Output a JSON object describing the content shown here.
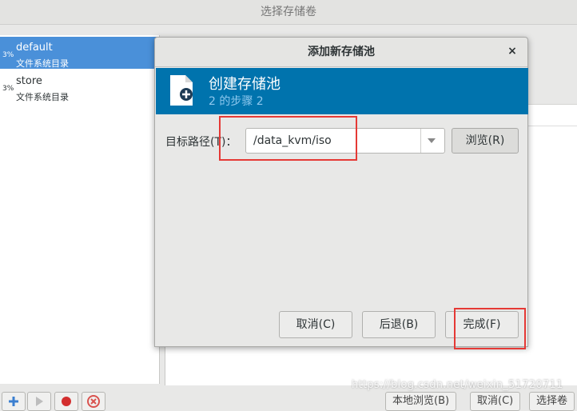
{
  "window": {
    "title": "选择存储卷"
  },
  "pools": [
    {
      "percent": "3%",
      "name": "default",
      "type": "文件系统目录",
      "selected": true
    },
    {
      "percent": "3%",
      "name": "store",
      "type": "文件系统目录",
      "selected": false
    }
  ],
  "bottom_buttons": {
    "browse_local": "本地浏览(B)",
    "cancel": "取消(C)",
    "choose_volume": "选择卷"
  },
  "dialog": {
    "title": "添加新存储池",
    "close_glyph": "×",
    "banner_title": "创建存储池",
    "banner_step": "2 的步骤 2",
    "target_path_label": "目标路径(T)：",
    "target_path_value": "/data_kvm/iso",
    "browse_label": "浏览(R)",
    "cancel_label": "取消(C)",
    "back_label": "后退(B)",
    "finish_label": "完成(F)"
  },
  "watermark": "https://blog.csdn.net/weixin_51720711",
  "icons": {
    "banner": "new-document-plus-icon",
    "add": "plus-icon",
    "play": "play-icon",
    "stop": "stop-icon",
    "delete": "delete-icon"
  },
  "colors": {
    "banner": "#0073ad",
    "selection": "#4a90d9",
    "highlight": "#e53935"
  }
}
